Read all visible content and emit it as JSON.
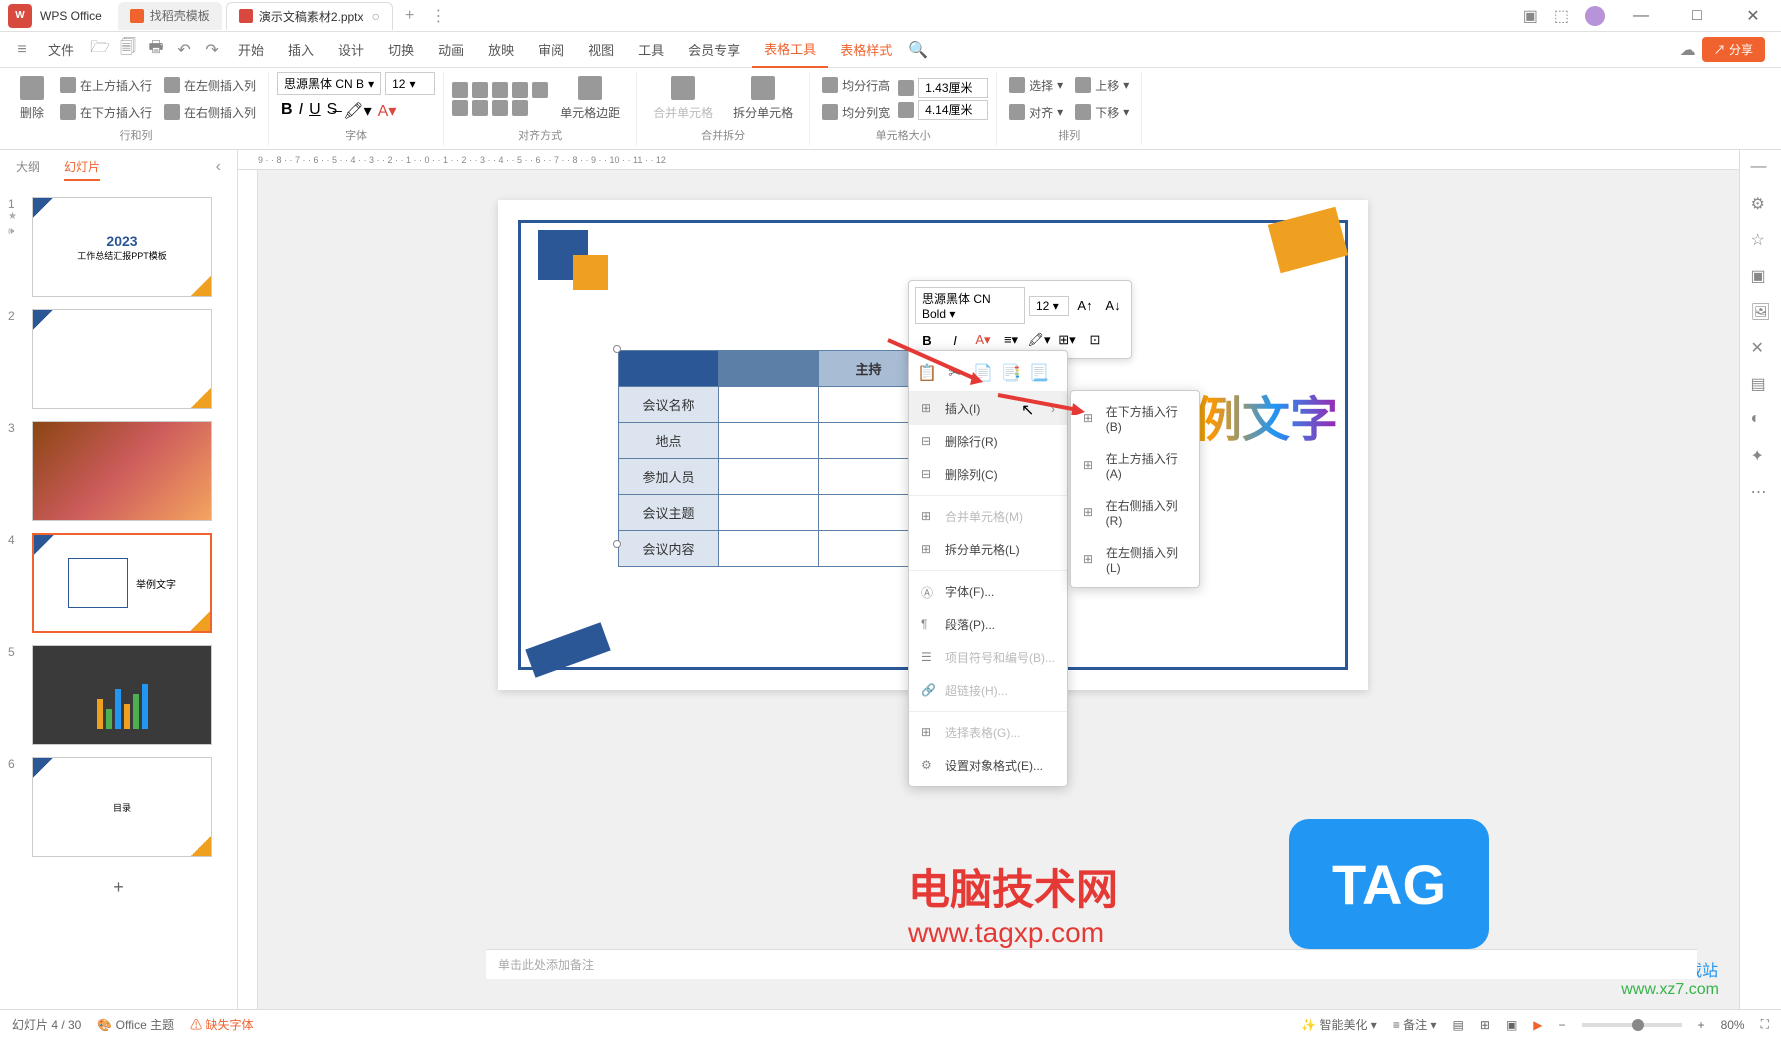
{
  "app": {
    "name": "WPS Office"
  },
  "tabs": [
    {
      "label": "找稻壳模板",
      "active": false
    },
    {
      "label": "演示文稿素材2.pptx",
      "active": true
    }
  ],
  "menu": {
    "file": "文件",
    "items": [
      "开始",
      "插入",
      "设计",
      "切换",
      "动画",
      "放映",
      "审阅",
      "视图",
      "工具",
      "会员专享"
    ],
    "active": [
      "表格工具",
      "表格样式"
    ],
    "share": "分享"
  },
  "ribbon": {
    "groups": {
      "rowcol": {
        "label": "行和列",
        "delete": "删除",
        "insert_above": "在上方插入行",
        "insert_below": "在下方插入行",
        "insert_left": "在左侧插入列",
        "insert_right": "在右侧插入列"
      },
      "font": {
        "label": "字体",
        "name": "思源黑体 CN B",
        "size": "12"
      },
      "align": {
        "label": "对齐方式",
        "margin": "单元格边距"
      },
      "mergesplit": {
        "label": "合并拆分",
        "merge": "合并单元格",
        "split": "拆分单元格"
      },
      "cellsize": {
        "label": "单元格大小",
        "rowheight": "均分行高",
        "colwidth": "均分列宽",
        "height_val": "1.43厘米",
        "width_val": "4.14厘米"
      },
      "arrange": {
        "label": "排列",
        "select": "选择",
        "align_btn": "对齐",
        "moveup": "上移",
        "movedown": "下移"
      }
    }
  },
  "sidebar": {
    "tabs": {
      "outline": "大纲",
      "slides": "幻灯片"
    },
    "slides": [
      {
        "num": "1",
        "title": "2023",
        "subtitle": "工作总结汇报PPT模板"
      },
      {
        "num": "2"
      },
      {
        "num": "3"
      },
      {
        "num": "4",
        "text": "举例文字"
      },
      {
        "num": "5"
      },
      {
        "num": "6",
        "text": "目录"
      }
    ]
  },
  "slide": {
    "table": {
      "header2": "主持",
      "rows": [
        "会议名称",
        "地点",
        "参加人员",
        "会议主题",
        "会议内容"
      ]
    },
    "example_text": "举例文字"
  },
  "float_toolbar": {
    "font": "思源黑体 CN Bold",
    "size": "12"
  },
  "context_menu": {
    "insert": "插入(I)",
    "delete_row": "删除行(R)",
    "delete_col": "删除列(C)",
    "merge": "合并单元格(M)",
    "split": "拆分单元格(L)",
    "font": "字体(F)...",
    "paragraph": "段落(P)...",
    "bullets": "项目符号和编号(B)...",
    "hyperlink": "超链接(H)...",
    "select_table": "选择表格(G)...",
    "format": "设置对象格式(E)..."
  },
  "submenu": {
    "insert_below": "在下方插入行(B)",
    "insert_above": "在上方插入行(A)",
    "insert_right": "在右侧插入列(R)",
    "insert_left": "在左侧插入列(L)"
  },
  "watermark": {
    "text1": "电脑技术网",
    "text2": "www.tagxp.com",
    "tag": "TAG",
    "site1": "极光下载站",
    "site2": "www.xz7.com"
  },
  "notes": {
    "placeholder": "单击此处添加备注"
  },
  "statusbar": {
    "slide_info": "幻灯片 4 / 30",
    "theme": "Office 主题",
    "missing_font": "缺失字体",
    "beautify": "智能美化",
    "notes_btn": "备注",
    "zoom": "80%"
  }
}
